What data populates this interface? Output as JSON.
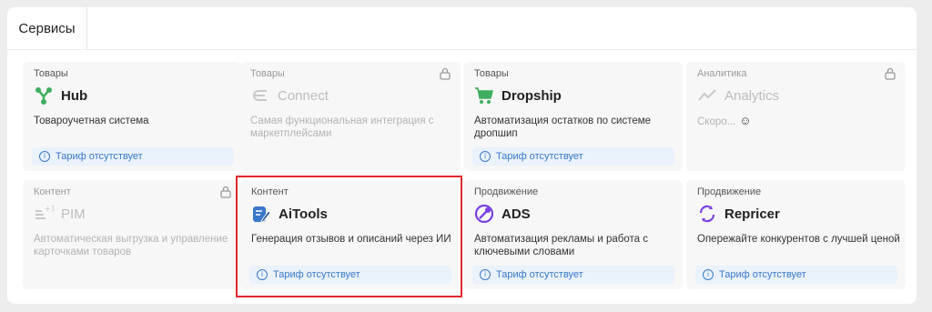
{
  "panel": {
    "tab_label": "Сервисы"
  },
  "cards": [
    {
      "category": "Товары",
      "title": "Hub",
      "description": "Товароучетная система",
      "badge": "Тариф отсутствует",
      "icon": "hub-icon"
    },
    {
      "category": "Товары",
      "title": "Connect",
      "description": "Самая функциональная интеграция с маркетплейсами",
      "icon": "connect-icon",
      "locked": true
    },
    {
      "category": "Товары",
      "title": "Dropship",
      "description": "Автоматизация остатков по системе дропшип",
      "badge": "Тариф отсутствует",
      "icon": "cart-icon"
    },
    {
      "category": "Аналитика",
      "title": "Analytics",
      "description": "Скоро...",
      "icon": "trend-icon",
      "locked": true
    },
    {
      "category": "Контент",
      "title": "PIM",
      "description": "Автоматическая выгрузка и управление карточками товаров",
      "icon": "pim-icon",
      "locked": true
    },
    {
      "category": "Контент",
      "title": "AiTools",
      "description": "Генерация отзывов и описаний через ИИ",
      "badge": "Тариф отсутствует",
      "icon": "ai-pen-icon"
    },
    {
      "category": "Продвижение",
      "title": "ADS",
      "description": "Автоматизация рекламы и работа с ключевыми словами",
      "badge": "Тариф отсутствует",
      "icon": "ads-icon"
    },
    {
      "category": "Продвижение",
      "title": "Repricer",
      "description": "Опережайте конкурентов с лучшей ценой",
      "badge": "Тариф отсутствует",
      "icon": "repricer-icon"
    }
  ],
  "badge_info_glyph": "i",
  "soon_emoji": "☺",
  "colors": {
    "accent_green": "#3fae5e",
    "accent_blue": "#3a78c9",
    "accent_purple": "#7b3fe4",
    "highlight_red": "#e0282e"
  }
}
